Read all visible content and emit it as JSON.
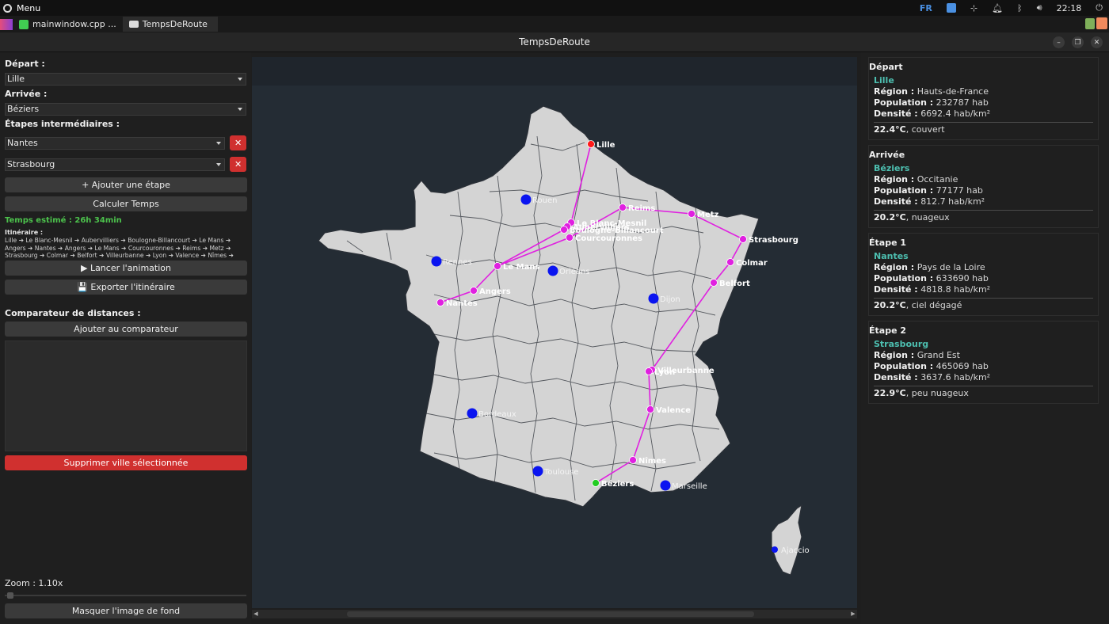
{
  "system": {
    "menu_label": "Menu",
    "lang": "FR",
    "time": "22:18"
  },
  "taskbar": {
    "tasks": [
      {
        "label": "mainwindow.cpp ..."
      },
      {
        "label": "TempsDeRoute"
      }
    ]
  },
  "window": {
    "title": "TempsDeRoute"
  },
  "left_panel": {
    "depart_label": "Départ :",
    "depart_value": "Lille",
    "arrivee_label": "Arrivée :",
    "arrivee_value": "Béziers",
    "etapes_label": "Étapes intermédiaires :",
    "etapes": [
      {
        "value": "Nantes",
        "remove": "✕"
      },
      {
        "value": "Strasbourg",
        "remove": "✕"
      }
    ],
    "add_step": "+ Ajouter une étape",
    "compute": "Calculer Temps",
    "temps_estime": "Temps estimé : 26h 34min",
    "itineraire_label": "Itinéraire :",
    "itineraire_text": "Lille ➔ Le Blanc-Mesnil ➔ Aubervilliers ➔ Boulogne-Billancourt ➔ Le Mans ➔ Angers ➔ Nantes ➔ Angers ➔ Le Mans ➔ Courcouronnes ➔ Reims ➔ Metz ➔ Strasbourg ➔ Colmar ➔ Belfort ➔ Villeurbanne ➔ Lyon ➔ Valence ➔ Nîmes ➔ Béziers",
    "animate": "▶ Lancer l'animation",
    "export": "💾 Exporter l'itinéraire",
    "comparateur_label": "Comparateur de distances :",
    "add_comparateur": "Ajouter au comparateur",
    "delete_city": "Supprimer ville sélectionnée",
    "zoom_label": "Zoom : 1.10x",
    "zoom_value": 1.1,
    "hide_bg": "Masquer l'image de fond"
  },
  "right_panel": {
    "cards": [
      {
        "title": "Départ",
        "city": "Lille",
        "region_label": "Région :",
        "region": "Hauts-de-France",
        "population_label": "Population :",
        "population": "232787 hab",
        "densite_label": "Densité :",
        "densite": "6692.4 hab/km²",
        "temp": "22.4°C",
        "meteo": ", couvert"
      },
      {
        "title": "Arrivée",
        "city": "Béziers",
        "region_label": "Région :",
        "region": "Occitanie",
        "population_label": "Population :",
        "population": "77177 hab",
        "densite_label": "Densité :",
        "densite": "812.7 hab/km²",
        "temp": "20.2°C",
        "meteo": ", nuageux"
      },
      {
        "title": "Étape 1",
        "city": "Nantes",
        "region_label": "Région :",
        "region": "Pays de la Loire",
        "population_label": "Population :",
        "population": "633690 hab",
        "densite_label": "Densité :",
        "densite": "4818.8 hab/km²",
        "temp": "20.2°C",
        "meteo": ", ciel dégagé"
      },
      {
        "title": "Étape 2",
        "city": "Strasbourg",
        "region_label": "Région :",
        "region": "Grand Est",
        "population_label": "Population :",
        "population": "465069 hab",
        "densite_label": "Densité :",
        "densite": "3637.6 hab/km²",
        "temp": "22.9°C",
        "meteo": ", peu nuageux"
      }
    ]
  },
  "map": {
    "colors": {
      "route": "#e020e0",
      "stop": "#e020e0",
      "city": "#0a14f0",
      "start": "#ff1a1a",
      "end": "#22cc22",
      "land": "#d4d4d4",
      "sea": "#242c34"
    },
    "route_cities": [
      {
        "name": "Lille",
        "kind": "start"
      },
      {
        "name": "Le Blanc-Mesnil",
        "kind": "stop"
      },
      {
        "name": "Aubervilliers",
        "kind": "stop"
      },
      {
        "name": "Boulogne-Billancourt",
        "kind": "stop"
      },
      {
        "name": "Courcouronnes",
        "kind": "stop"
      },
      {
        "name": "Le Mans",
        "kind": "stop"
      },
      {
        "name": "Angers",
        "kind": "stop"
      },
      {
        "name": "Nantes",
        "kind": "stop"
      },
      {
        "name": "Reims",
        "kind": "stop"
      },
      {
        "name": "Metz",
        "kind": "stop"
      },
      {
        "name": "Strasbourg",
        "kind": "stop"
      },
      {
        "name": "Colmar",
        "kind": "stop"
      },
      {
        "name": "Belfort",
        "kind": "stop"
      },
      {
        "name": "Villeurbanne",
        "kind": "stop"
      },
      {
        "name": "Lyon",
        "kind": "stop"
      },
      {
        "name": "Valence",
        "kind": "stop"
      },
      {
        "name": "Nîmes",
        "kind": "stop"
      },
      {
        "name": "Béziers",
        "kind": "end"
      }
    ],
    "other_cities": [
      "Rouen",
      "Rennes",
      "Orléans",
      "Dijon",
      "Bordeaux",
      "Toulouse",
      "Marseille",
      "Ajaccio"
    ]
  }
}
